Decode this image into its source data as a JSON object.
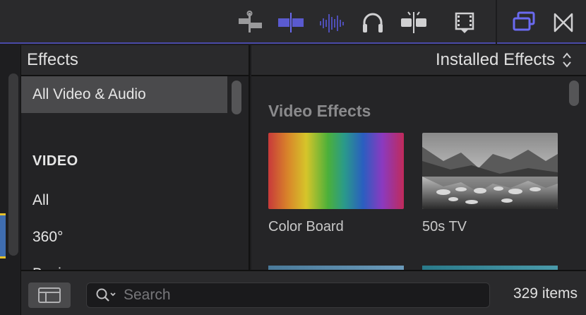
{
  "toolbar": {
    "icons": [
      "clip-appearance-icon",
      "snapping-icon",
      "audio-waveform-icon",
      "headphones-icon",
      "skimming-icon",
      "video-frame-icon",
      "show-browser-icon",
      "transitions-browser-icon"
    ],
    "accent": "#6a6af0"
  },
  "categories": {
    "title": "Effects",
    "items": [
      "All Video & Audio",
      "VIDEO",
      "All",
      "360°",
      "Basics"
    ]
  },
  "effects": {
    "filter_label": "Installed Effects",
    "section_title": "Video Effects",
    "items": [
      {
        "name": "Color Board"
      },
      {
        "name": "50s TV"
      }
    ]
  },
  "bottom": {
    "search_placeholder": "Search",
    "item_count": "329 items"
  }
}
